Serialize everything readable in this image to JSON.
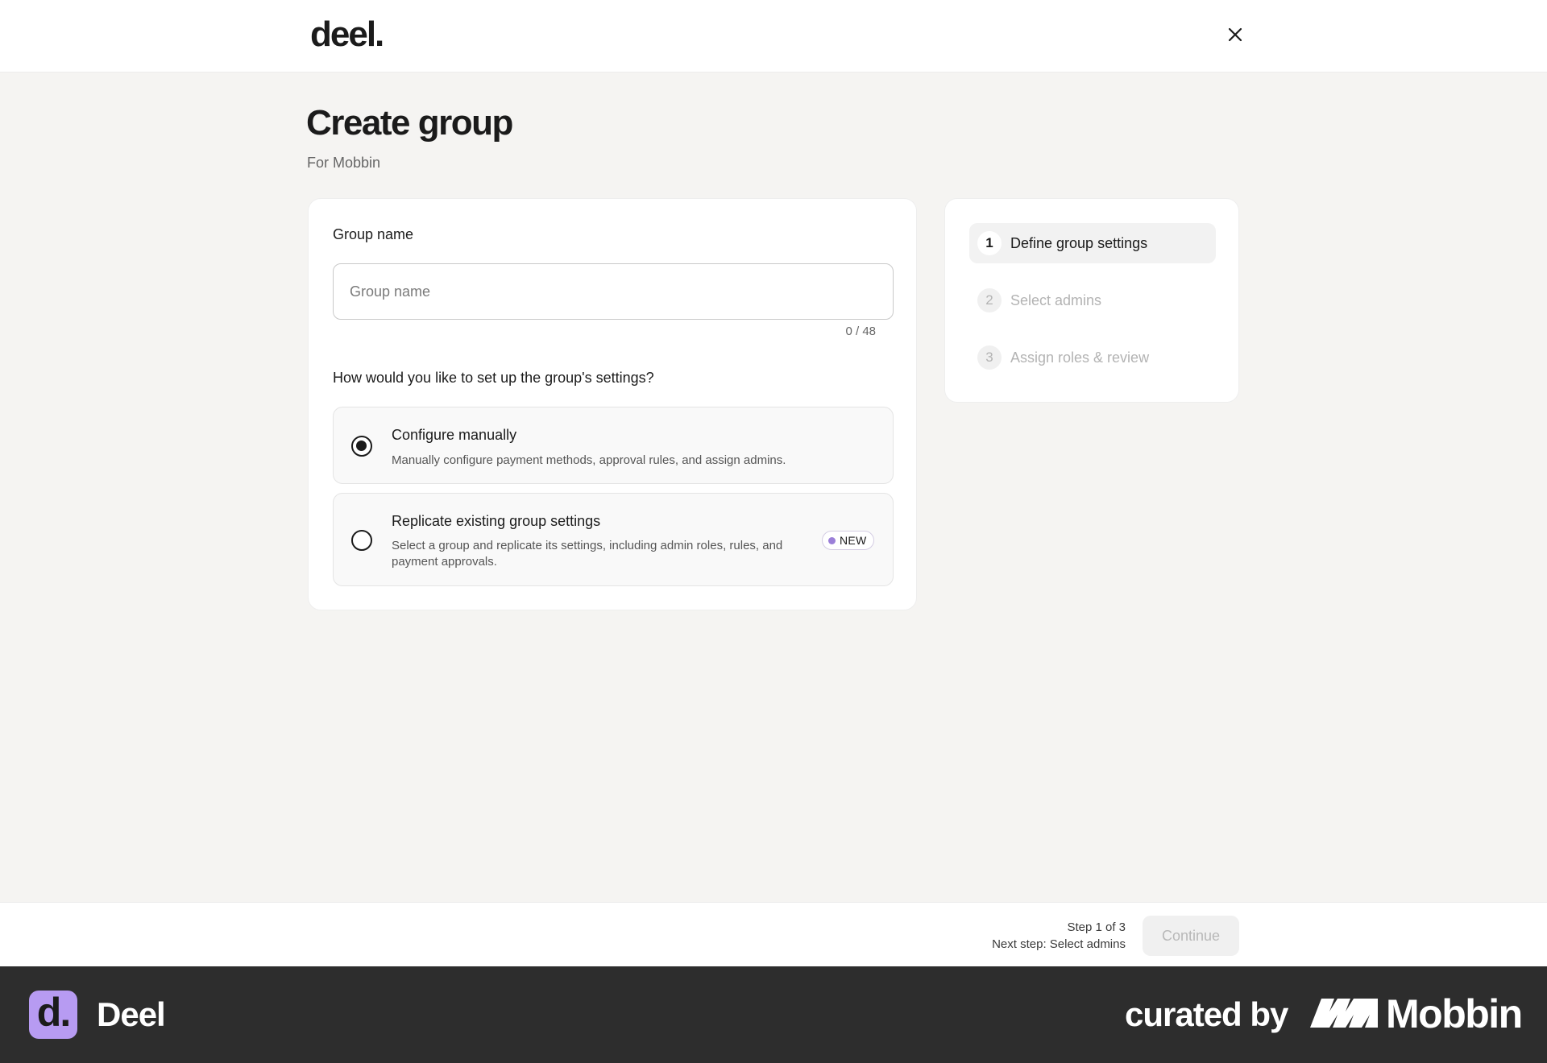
{
  "header": {
    "logo_text": "deel.",
    "close_icon": "close-icon"
  },
  "page": {
    "title": "Create group",
    "subtitle": "For Mobbin"
  },
  "form": {
    "group_name_label": "Group name",
    "group_name_value": "",
    "group_name_placeholder": "Group name",
    "char_count": "0 / 48",
    "question": "How would you like to set up the group's settings?",
    "options": [
      {
        "title": "Configure manually",
        "description": "Manually configure payment methods, approval rules, and assign admins.",
        "selected": true
      },
      {
        "title": "Replicate existing group settings",
        "description": "Select a group and replicate its settings, including admin roles, rules, and payment approvals.",
        "selected": false,
        "badge": "NEW"
      }
    ]
  },
  "steps": [
    {
      "number": "1",
      "label": "Define group settings",
      "active": true
    },
    {
      "number": "2",
      "label": "Select admins",
      "active": false
    },
    {
      "number": "3",
      "label": "Assign roles & review",
      "active": false
    }
  ],
  "footer_bar": {
    "step_status": "Step 1 of 3",
    "next_step": "Next step: Select admins",
    "continue_label": "Continue"
  },
  "banner": {
    "app_icon_text": "d.",
    "app_name": "Deel",
    "curated_by": "curated by",
    "brand": "Mobbin"
  },
  "colors": {
    "page_bg": "#f5f4f2",
    "badge_dot": "#9b7fd8",
    "app_icon_bg": "#b79bf2",
    "banner_bg": "#2d2d2d"
  }
}
